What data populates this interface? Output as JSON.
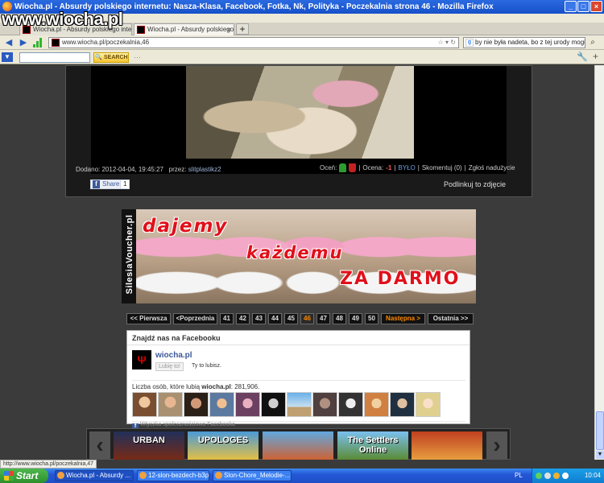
{
  "window": {
    "title": "Wiocha.pl - Absurdy polskiego internetu: Nasza-Klasa, Facebook, Fotka, Nk, Polityka - Poczekalnia strona 46 - Mozilla Firefox",
    "site_watermark": "www.wiocha.pl"
  },
  "tabs": [
    {
      "label": "Wiocha.pl - Absurdy polskiego internetu: ..."
    },
    {
      "label": "Wiocha.pl - Absurdy polskiego internetu: ..."
    }
  ],
  "nav": {
    "url": "www.wiocha.pl/poczekalnia,46",
    "search_value": "by nie była nadeta, bo z tej urody mogłaby"
  },
  "toolbar": {
    "search_label": "SEARCH"
  },
  "post": {
    "added_label": "Dodano:",
    "added_date": "2012-04-04, 19:45:27",
    "by_label": "przez:",
    "author": "slitplastikz2",
    "rate_label": "Oceń:",
    "score_label": "Ocena:",
    "score": "-1",
    "byl_label": "BYŁO",
    "comments_label": "Skomentuj (0)",
    "report_label": "Zgłoś nadużycie",
    "share_label": "Share",
    "share_count": "1",
    "permalink_label": "Podlinkuj to zdjęcie"
  },
  "banner": {
    "brand": "SilesiaVoucher.pl",
    "line1": "dajemy",
    "line2": "każdemu",
    "line3": "ZA DARMO"
  },
  "pager": {
    "first": "<< Pierwsza",
    "prev": "<Poprzednia",
    "pages": [
      "41",
      "42",
      "43",
      "44",
      "45",
      "46",
      "47",
      "48",
      "49",
      "50"
    ],
    "current": "46",
    "next": "Następna >",
    "last": "Ostatnia >>"
  },
  "facebook": {
    "header": "Znajdź nas na Facebooku",
    "page_name": "wiocha.pl",
    "like_button": "Lubię to!",
    "you_like": "Ty to lubisz.",
    "count_label": "Liczba osób, które lubią",
    "count_page": "wiocha.pl",
    "count_value": ": 281,906.",
    "footer": "Wtyczka społecznościowa Facebooka"
  },
  "games": {
    "items": [
      "URBAN",
      "UPOLOGES",
      "",
      "The Settlers Online",
      ""
    ]
  },
  "status": {
    "url": "http://www.wiocha.pl/poczekalnia,47"
  },
  "taskbar": {
    "start": "Start",
    "items": [
      "Wiocha.pl - Absurdy ...",
      "12-slon-bezdech-b3pl...",
      "Slon-Chore_Melodie-..."
    ],
    "lang": "PL",
    "clock": "10:04"
  },
  "colors": {
    "page_bg": "#3b3b3b",
    "accent_orange": "#ff8a00",
    "banner_red": "#e0101a",
    "fb_blue": "#3b5998",
    "xp_blue": "#2457d6"
  }
}
